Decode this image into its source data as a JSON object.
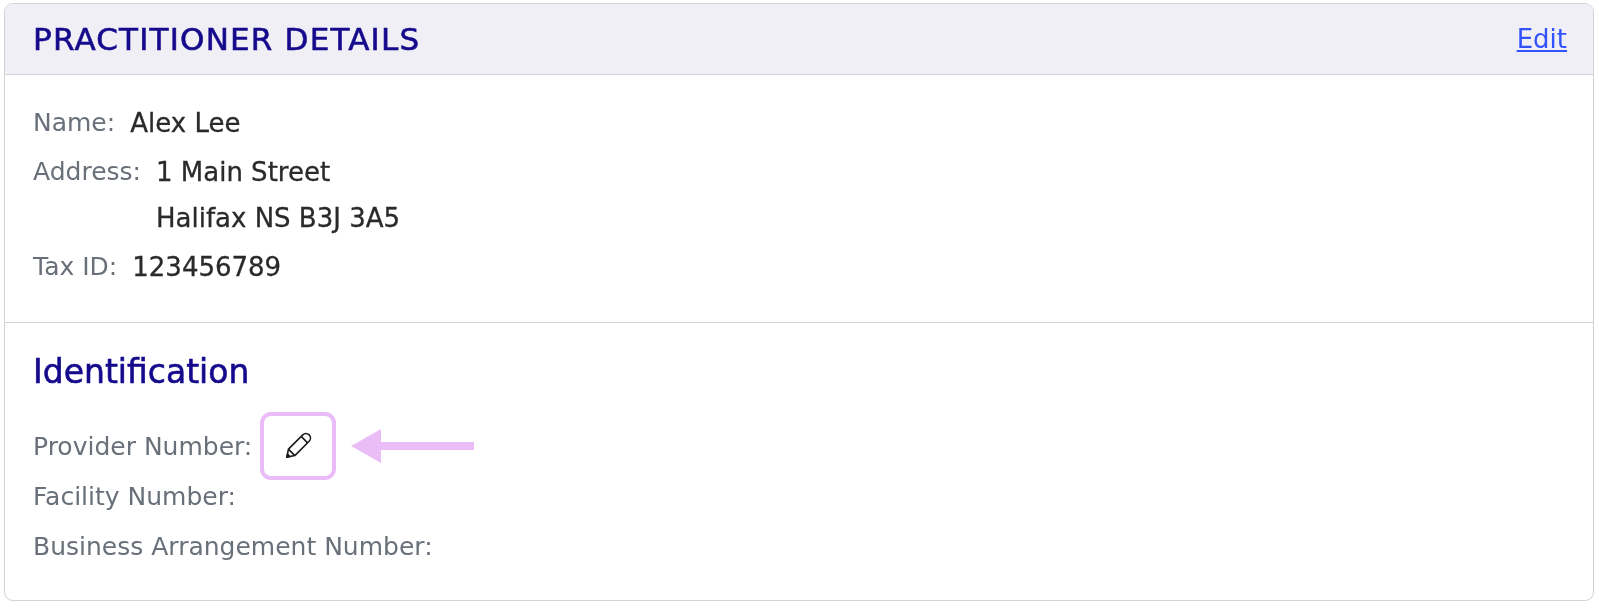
{
  "panel": {
    "title": "PRACTITIONER DETAILS",
    "edit_link": "Edit"
  },
  "details": [
    {
      "label": "Name:",
      "value_lines": [
        "Alex Lee"
      ]
    },
    {
      "label": "Address:",
      "value_lines": [
        "1 Main Street",
        "Halifax NS B3J 3A5"
      ]
    },
    {
      "label": "Tax ID:",
      "value_lines": [
        "123456789"
      ]
    }
  ],
  "identification": {
    "heading": "Identification",
    "fields": [
      {
        "label": "Provider Number:",
        "kind": "edit",
        "edit_button": {
          "highlighted": true
        }
      },
      {
        "label": "Facility Number:",
        "kind": "empty"
      },
      {
        "label": "Business Arrangement Number:",
        "kind": "empty"
      }
    ]
  }
}
